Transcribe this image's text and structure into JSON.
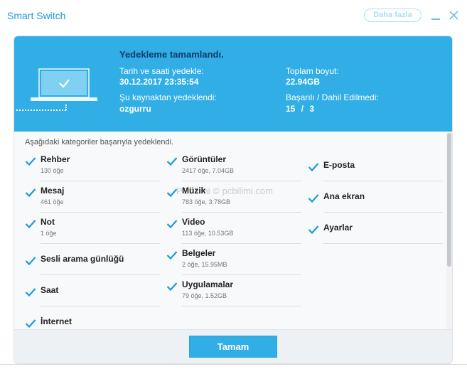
{
  "window": {
    "title": "Smart Switch",
    "more_label": "Daha fazla"
  },
  "header": {
    "title": "Yedekleme tamamlandı.",
    "date_label": "Tarih ve saati yedekle:",
    "date_value": "30.12.2017 23:35:54",
    "source_label": "Şu kaynaktan yedeklendi:",
    "source_value": "ozgurru",
    "size_label": "Toplam boyut:",
    "size_value": "22.94GB",
    "result_label": "Başarılı / Dahil Edilmedi:",
    "result_success": "15",
    "result_sep": "/",
    "result_excluded": "3"
  },
  "content": {
    "subtitle": "Aşağıdaki kategoriler başarıyla yedeklendi.",
    "watermark": "PCbilimi © pcbilimi.com",
    "columns": [
      [
        {
          "name": "Rehber",
          "sub": "130 öğe"
        },
        {
          "name": "Mesaj",
          "sub": "461 öğe"
        },
        {
          "name": "Not",
          "sub": "1 öğe"
        },
        {
          "name": "Sesli arama günlüğü",
          "sub": ""
        },
        {
          "name": "Saat",
          "sub": ""
        },
        {
          "name": "İnternet",
          "sub": ""
        }
      ],
      [
        {
          "name": "Görüntüler",
          "sub": "2417 öğe, 7.04GB"
        },
        {
          "name": "Müzik",
          "sub": "783 öğe, 3.78GB"
        },
        {
          "name": "Video",
          "sub": "113 öğe, 10.53GB"
        },
        {
          "name": "Belgeler",
          "sub": "2 öğe, 15.95MB"
        },
        {
          "name": "Uygulamalar",
          "sub": "79 öğe, 1.52GB"
        }
      ],
      [
        {
          "name": "E-posta",
          "sub": ""
        },
        {
          "name": "Ana ekran",
          "sub": ""
        },
        {
          "name": "Ayarlar",
          "sub": ""
        }
      ]
    ]
  },
  "footer": {
    "ok_label": "Tamam"
  },
  "colors": {
    "accent": "#31aee5",
    "title_dark": "#0e3c6b",
    "check": "#1d9ad6"
  }
}
